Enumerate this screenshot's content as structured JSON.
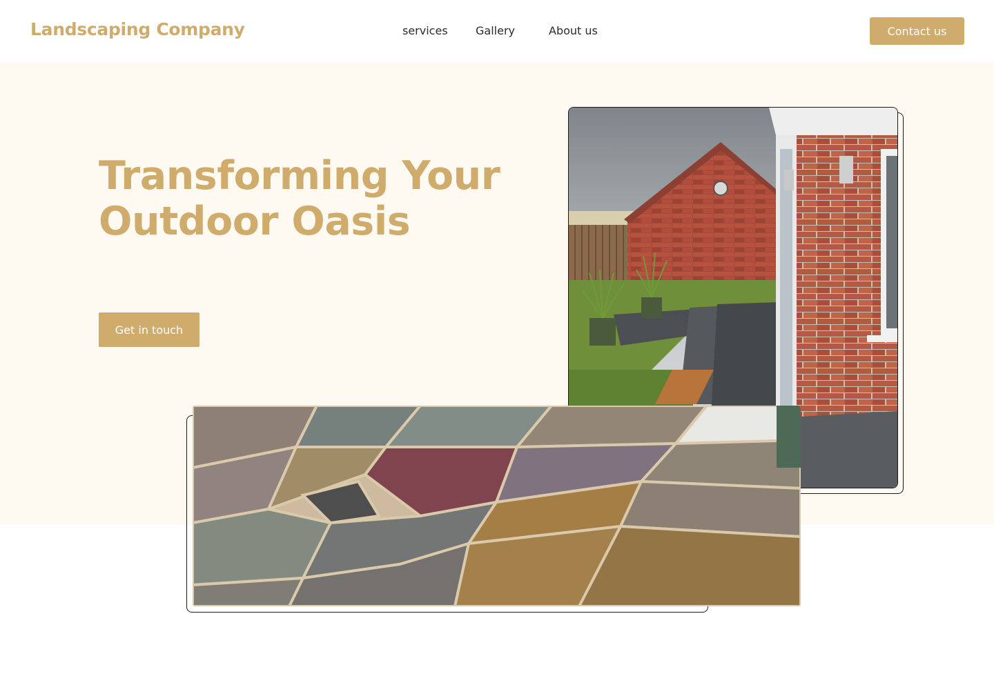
{
  "header": {
    "logo": "Landscaping Company",
    "nav": {
      "services": "services",
      "gallery": "Gallery",
      "about": "About us"
    },
    "contact_label": "Contact us"
  },
  "hero": {
    "title_line1": "Transforming Your",
    "title_line2": "Outdoor Oasis",
    "cta_label": "Get in touch"
  },
  "colors": {
    "brand": "#cfac6b",
    "hero_background": "#fffaf1",
    "nav_text": "#2b2b2b"
  }
}
